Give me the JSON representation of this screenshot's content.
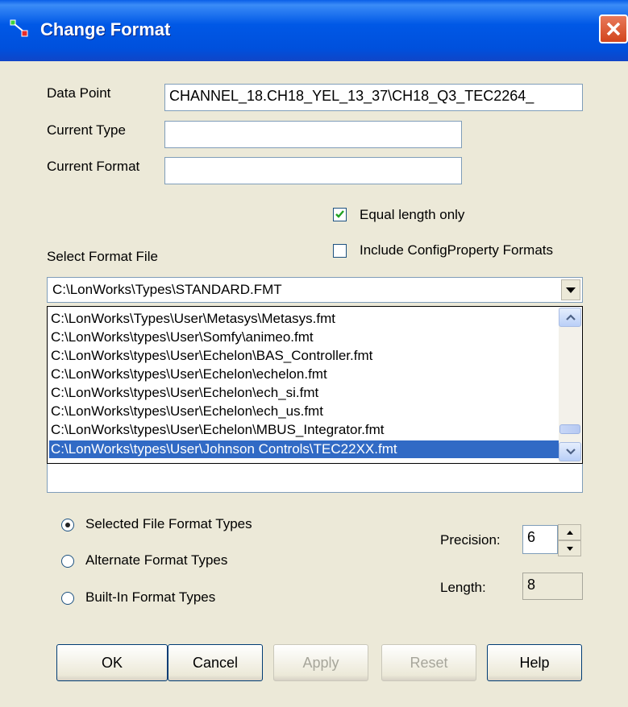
{
  "window": {
    "title": "Change Format"
  },
  "fields": {
    "data_point_label": "Data Point",
    "data_point_value": "CHANNEL_18.CH18_YEL_13_37\\CH18_Q3_TEC2264_",
    "current_type_label": "Current Type",
    "current_type_value": "",
    "current_format_label": "Current Format",
    "current_format_value": ""
  },
  "options": {
    "equal_length_label": "Equal length only",
    "equal_length_checked": true,
    "include_config_label": "Include ConfigProperty Formats",
    "include_config_checked": false
  },
  "format_file": {
    "label": "Select Format File",
    "selected": "C:\\LonWorks\\Types\\STANDARD.FMT",
    "items": [
      "C:\\LonWorks\\Types\\User\\Metasys\\Metasys.fmt",
      "C:\\LonWorks\\types\\User\\Somfy\\animeo.fmt",
      "C:\\LonWorks\\types\\User\\Echelon\\BAS_Controller.fmt",
      "C:\\LonWorks\\types\\User\\Echelon\\echelon.fmt",
      "C:\\LonWorks\\types\\User\\Echelon\\ech_si.fmt",
      "C:\\LonWorks\\types\\User\\Echelon\\ech_us.fmt",
      "C:\\LonWorks\\types\\User\\Echelon\\MBUS_Integrator.fmt",
      "C:\\LonWorks\\types\\User\\Johnson Controls\\TEC22XX.fmt"
    ],
    "highlighted_item": "C:\\LonWorks\\types\\User\\Johnson Controls\\TEC22XX.fmt"
  },
  "format_types": {
    "selected_file_label": "Selected File Format Types",
    "alternate_label": "Alternate Format Types",
    "builtin_label": "Built-In Format Types",
    "selected": "Selected File Format Types"
  },
  "precision": {
    "label": "Precision:",
    "value": "6"
  },
  "length": {
    "label": "Length:",
    "value": "8"
  },
  "buttons": {
    "ok": "OK",
    "cancel": "Cancel",
    "apply": "Apply",
    "reset": "Reset",
    "help": "Help"
  },
  "colors": {
    "titlebar": "#0058e6",
    "selection": "#316ac5",
    "dialog_bg": "#ece9d8"
  }
}
